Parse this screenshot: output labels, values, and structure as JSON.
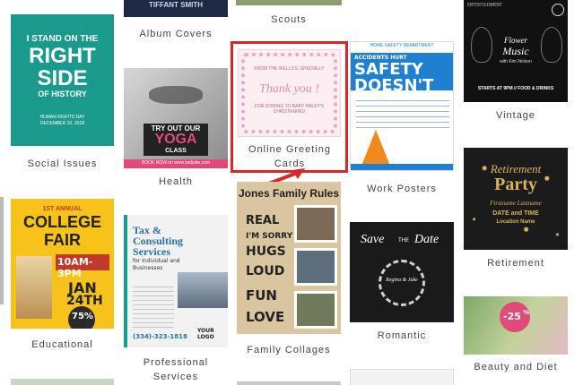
{
  "captions": {
    "album_covers": "Album Covers",
    "scouts": "Scouts",
    "vintage": "Vintage",
    "social_issues": "Social Issues",
    "health": "Health",
    "online_greeting": "Online Greeting Cards",
    "work_posters": "Work Posters",
    "retirement": "Retirement",
    "educational": "Educational",
    "professional_services": "Professional Services",
    "family_collages": "Family Collages",
    "romantic": "Romantic",
    "beauty_diet": "Beauty and Diet"
  },
  "cards": {
    "album_top": "TIFFANT SMITH",
    "social": {
      "line1": "I STAND ON THE",
      "line2": "RIGHT",
      "line3": "SIDE",
      "line4": "OF HISTORY",
      "footer1": "HUMAN RIGHTS DAY",
      "footer2": "DECEMBER 10, 2018"
    },
    "yoga": {
      "line1": "TRY OUT OUR",
      "line2": "YOGA",
      "line3": "CLASS",
      "footer": "BOOK NOW on www.website.com"
    },
    "greeting": {
      "top": "FROM THE WELLS'S, SPECIALLY",
      "main": "Thank you !",
      "sub": "FOR COMING TO BABY HALEY'S CHRISTENING!"
    },
    "safety": {
      "header": "HOME SAFETY DEPARTMENT",
      "small": "ACCIDENTS HURT",
      "line1": "SAFETY",
      "line2": "DOESN'T"
    },
    "vintage": {
      "top": "ENTERTAINMENT",
      "title1": "Flower",
      "title2": "Music",
      "sub": "with Kim Nelson",
      "foot": "STARTS AT 9PM // FOOD & DRINKS"
    },
    "retirement": {
      "line1": "Retirement",
      "line2": "Party",
      "name": "Firstname Lastname",
      "date": "DATE and TIME",
      "loc": "Location Name"
    },
    "college": {
      "top": "1ST ANNUAL",
      "line1": "COLLEGE",
      "line2": "FAIR",
      "time": "10AM-3PM",
      "date1": "JAN",
      "date2": "24TH",
      "off": "75%",
      "off2": "OFF"
    },
    "tax": {
      "title1": "Tax &",
      "title2": "Consulting",
      "title3": "Services",
      "sub": "for Individual and Businesses",
      "phone": "(334)-323-1818",
      "logo": "YOUR LOGO"
    },
    "family": {
      "title": "Jones Family Rules",
      "r1": "REAL",
      "r2": "I'M SORRY",
      "r3": "HUGS",
      "r4": "LOUD",
      "r5": "FUN",
      "r6": "LOVE"
    },
    "romantic": {
      "save": "Save",
      "the": "THE",
      "date": "Date",
      "names": "Regina & Jake"
    },
    "beauty": {
      "off": "-25",
      "pct": "%"
    }
  },
  "colors": {
    "teal": "#1a9a8c",
    "yoga_bar": "#e14b7a",
    "greeting_pink": "#e58ba8",
    "safety_blue": "#1f7fd0",
    "highlight_red": "#d62828",
    "gold": "#d9b25a",
    "tax_blue": "#2a6fa8",
    "college_yellow": "#f7c21a"
  }
}
